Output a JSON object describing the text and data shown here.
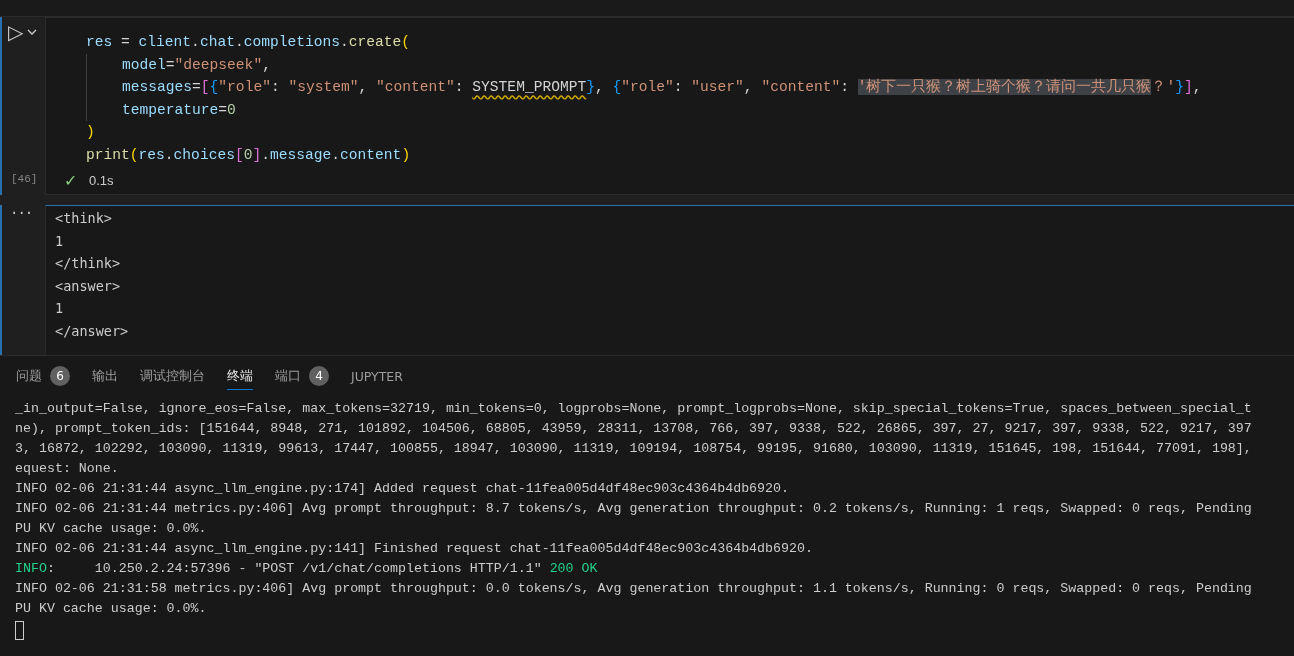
{
  "code_cell": {
    "run_icon": "▷",
    "lines": [
      {
        "kind": "top",
        "tokens": [
          {
            "kind": "var",
            "text": "res"
          },
          {
            "kind": "punct",
            "text": " = "
          },
          {
            "kind": "var",
            "text": "client"
          },
          {
            "kind": "punct",
            "text": "."
          },
          {
            "kind": "var",
            "text": "chat"
          },
          {
            "kind": "punct",
            "text": "."
          },
          {
            "kind": "var",
            "text": "completions"
          },
          {
            "kind": "punct",
            "text": "."
          },
          {
            "kind": "func",
            "text": "create"
          },
          {
            "kind": "b1",
            "text": "("
          }
        ]
      },
      {
        "kind": "nested",
        "tokens": [
          {
            "kind": "var",
            "text": "model"
          },
          {
            "kind": "punct",
            "text": "="
          },
          {
            "kind": "str",
            "text": "\"deepseek\""
          },
          {
            "kind": "punct",
            "text": ","
          }
        ]
      },
      {
        "kind": "nested",
        "tokens": [
          {
            "kind": "var",
            "text": "messages"
          },
          {
            "kind": "punct",
            "text": "="
          },
          {
            "kind": "b2",
            "text": "["
          },
          {
            "kind": "b3",
            "text": "{"
          },
          {
            "kind": "str",
            "text": "\"role\""
          },
          {
            "kind": "punct",
            "text": ": "
          },
          {
            "kind": "str",
            "text": "\"system\""
          },
          {
            "kind": "punct",
            "text": ", "
          },
          {
            "kind": "str",
            "text": "\"content\""
          },
          {
            "kind": "punct",
            "text": ": "
          },
          {
            "kind": "warn",
            "text": "SYSTEM_PROMPT"
          },
          {
            "kind": "b3",
            "text": "}"
          },
          {
            "kind": "punct",
            "text": ", "
          },
          {
            "kind": "b3",
            "text": "{"
          },
          {
            "kind": "str",
            "text": "\"role\""
          },
          {
            "kind": "punct",
            "text": ": "
          },
          {
            "kind": "str",
            "text": "\"user\""
          },
          {
            "kind": "punct",
            "text": ", "
          },
          {
            "kind": "str",
            "text": "\"content\""
          },
          {
            "kind": "punct",
            "text": ": "
          },
          {
            "kind": "selected",
            "text": "'树下一只猴？树上骑个猴？请问一共几只猴"
          },
          {
            "kind": "str",
            "text": "？'"
          },
          {
            "kind": "b3",
            "text": "}"
          },
          {
            "kind": "b2",
            "text": "]"
          },
          {
            "kind": "punct",
            "text": ","
          }
        ]
      },
      {
        "kind": "nested",
        "tokens": [
          {
            "kind": "var",
            "text": "temperature"
          },
          {
            "kind": "punct",
            "text": "="
          },
          {
            "kind": "num",
            "text": "0"
          }
        ]
      },
      {
        "kind": "top",
        "tokens": [
          {
            "kind": "b1",
            "text": ")"
          }
        ]
      },
      {
        "kind": "top",
        "tokens": [
          {
            "kind": "func",
            "text": "print"
          },
          {
            "kind": "b1",
            "text": "("
          },
          {
            "kind": "var",
            "text": "res"
          },
          {
            "kind": "punct",
            "text": "."
          },
          {
            "kind": "var",
            "text": "choices"
          },
          {
            "kind": "b2",
            "text": "["
          },
          {
            "kind": "num",
            "text": "0"
          },
          {
            "kind": "b2",
            "text": "]"
          },
          {
            "kind": "punct",
            "text": "."
          },
          {
            "kind": "var",
            "text": "message"
          },
          {
            "kind": "punct",
            "text": "."
          },
          {
            "kind": "var",
            "text": "content"
          },
          {
            "kind": "b1",
            "text": ")"
          }
        ]
      }
    ],
    "execution_count": "[46]",
    "status_icon": "✓",
    "duration": "0.1s"
  },
  "output_cell": {
    "menu": "···",
    "lines": [
      "<think>",
      "1",
      "</think>",
      "<answer>",
      "1",
      "</answer>"
    ]
  },
  "panel_tabs": [
    {
      "label": "问题",
      "badge": "6",
      "selected": false
    },
    {
      "label": "输出",
      "selected": false
    },
    {
      "label": "调试控制台",
      "selected": false
    },
    {
      "label": "终端",
      "selected": true
    },
    {
      "label": "端口",
      "badge": "4",
      "selected": false
    },
    {
      "label": "JUPYTER",
      "selected": false
    }
  ],
  "terminal": {
    "lines": [
      [
        {
          "kind": "plain",
          "text": "_in_output=False, ignore_eos=False, max_tokens=32719, min_tokens=0, logprobs=None, prompt_logprobs=None, skip_special_tokens=True, spaces_between_special_t"
        }
      ],
      [
        {
          "kind": "plain",
          "text": "ne), prompt_token_ids: [151644, 8948, 271, 101892, 104506, 68805, 43959, 28311, 13708, 766, 397, 9338, 522, 26865, 397, 27, 9217, 397, 9338, 522, 9217, 397"
        }
      ],
      [
        {
          "kind": "plain",
          "text": "3, 16872, 102292, 103090, 11319, 99613, 17447, 100855, 18947, 103090, 11319, 109194, 108754, 99195, 91680, 103090, 11319, 151645, 198, 151644, 77091, 198],"
        }
      ],
      [
        {
          "kind": "plain",
          "text": "equest: None."
        }
      ],
      [
        {
          "kind": "plain",
          "text": "INFO 02-06 21:31:44 async_llm_engine.py:174] Added request chat-11fea005d4df48ec903c4364b4db6920."
        }
      ],
      [
        {
          "kind": "plain",
          "text": "INFO 02-06 21:31:44 metrics.py:406] Avg prompt throughput: 8.7 tokens/s, Avg generation throughput: 0.2 tokens/s, Running: 1 reqs, Swapped: 0 reqs, Pending"
        }
      ],
      [
        {
          "kind": "plain",
          "text": "PU KV cache usage: 0.0%."
        }
      ],
      [
        {
          "kind": "plain",
          "text": "INFO 02-06 21:31:44 async_llm_engine.py:141] Finished request chat-11fea005d4df48ec903c4364b4db6920."
        }
      ],
      [
        {
          "kind": "green",
          "text": "INFO"
        },
        {
          "kind": "plain",
          "text": ":     10.250.2.24:57396 - \"POST /v1/chat/completions HTTP/1.1\" "
        },
        {
          "kind": "green",
          "text": "200 OK"
        }
      ],
      [
        {
          "kind": "plain",
          "text": "INFO 02-06 21:31:58 metrics.py:406] Avg prompt throughput: 0.0 tokens/s, Avg generation throughput: 1.1 tokens/s, Running: 0 reqs, Swapped: 0 reqs, Pending"
        }
      ],
      [
        {
          "kind": "plain",
          "text": "PU KV cache usage: 0.0%."
        }
      ]
    ]
  }
}
